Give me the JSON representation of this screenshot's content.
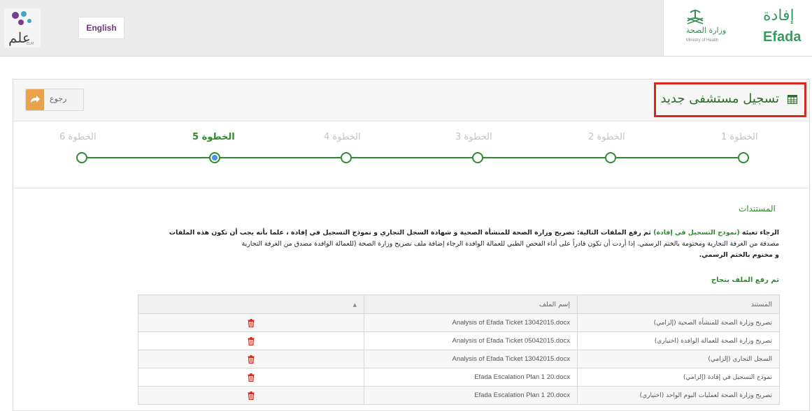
{
  "header": {
    "lang_button": "English",
    "elm_logo_text": "علم",
    "elm_logo_sub": "ELM",
    "moh_ar": "وزارة الصحة",
    "moh_en": "Ministry of Health",
    "efada_ar": "إفادة",
    "efada_en": "Efada"
  },
  "panel": {
    "title": "تسجيل مستشفى جديد",
    "back_label": "رجوع"
  },
  "steps": [
    {
      "label": "الخطوة 1",
      "state": "done"
    },
    {
      "label": "الخطوة 2",
      "state": "done"
    },
    {
      "label": "الخطوة 3",
      "state": "done"
    },
    {
      "label": "الخطوة 4",
      "state": "done"
    },
    {
      "label": "الخطوة 5",
      "state": "active"
    },
    {
      "label": "الخطوة 6",
      "state": "pending"
    }
  ],
  "documents": {
    "section_title": "المستندات",
    "desc_prefix": "الرجاء تعبئة ",
    "desc_highlight": "(نموذج التسجيل في إفادة)",
    "desc_bold": " ثم رفع الملفات التالية: تصريح وزارة الصحة للمنشأة الصحية و شهادة السجل التجاري و نموذج التسجيل في إفادة ، علما بأنه يجب أن تكون هذه الملفات",
    "desc_rest": "مصدقة من الغرفة التجارية ومختومة بالختم الرسمي. إذا أردت أن تكون قادراً على أداء الفحص الطبي للعمالة الوافدة الرجاء إضافة ملف تصريح وزارة الصحة (للعمالة الوافدة مصدق من الغرفة التجارية",
    "desc_end": "و مختوم بالختم الرسمي.",
    "success_msg": "تم رفع الملف بنجاح",
    "columns": {
      "document": "المستند",
      "filename": "إسم الملف",
      "action": ""
    },
    "rows": [
      {
        "document": "تصريح وزارة الصحة للمنشأة الصحية (إلزامي)",
        "filename": "Analysis of Efada Ticket 13042015.docx"
      },
      {
        "document": "تصريح وزارة الصحة للعمالة الوافدة (اختياري)",
        "filename": "Analysis of Efada Ticket 05042015.docx"
      },
      {
        "document": "السجل التجاري (إلزامي)",
        "filename": "Analysis of Efada Ticket 13042015.docx"
      },
      {
        "document": "نموذج التسجيل في إفادة (إلزامي)",
        "filename": "Efada Escalation Plan 1 20.docx"
      },
      {
        "document": "تصريح وزارة الصحة لعمليات اليوم الواحد (اختياري)",
        "filename": "Efada Escalation Plan 1 20.docx"
      }
    ]
  },
  "colors": {
    "accent_green": "#2e8b2e",
    "highlight_red": "#d9281c",
    "back_orange": "#e8a24a"
  }
}
